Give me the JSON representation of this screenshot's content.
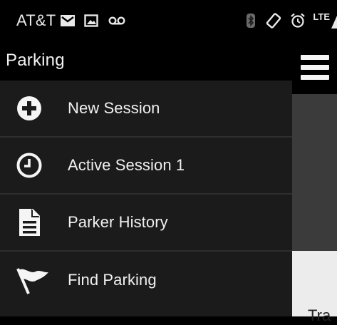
{
  "status_bar": {
    "carrier": "AT&T",
    "network_label": "LTE",
    "left_icons": [
      "mail-icon",
      "gallery-icon",
      "voicemail-icon"
    ],
    "right_icons": [
      "bluetooth-icon",
      "screen-rotation-icon",
      "alarm-icon",
      "signal-icon"
    ]
  },
  "drawer": {
    "title": "Parking",
    "items": [
      {
        "label": "New Session",
        "icon": "add-circle-icon"
      },
      {
        "label": "Active Session 1",
        "icon": "clock-icon"
      },
      {
        "label": "Parker History",
        "icon": "document-icon"
      },
      {
        "label": "Find Parking",
        "icon": "flag-icon"
      }
    ]
  },
  "background_app": {
    "menu_icon": "hamburger-menu-icon",
    "partial_text": "Tra"
  },
  "colors": {
    "status_bar_bg": "#000000",
    "drawer_bg": "#1b1b1b",
    "drawer_header_bg": "#000000",
    "divider": "#2e2e2e",
    "text": "#f0f0f0",
    "app_dark_panel": "#3b3b3b",
    "app_light_panel": "#ececec"
  }
}
